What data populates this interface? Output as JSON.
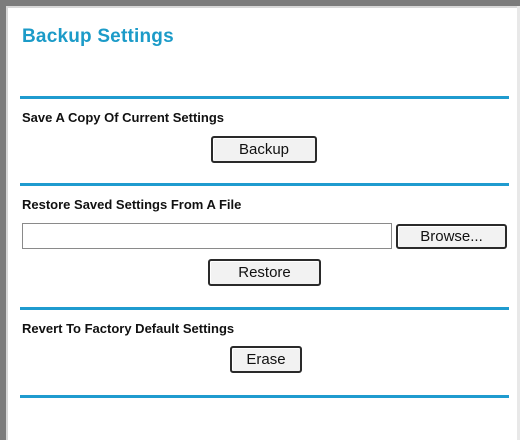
{
  "page": {
    "title": "Backup Settings"
  },
  "backup_section": {
    "label": "Save A Copy Of Current Settings",
    "button_label": "Backup"
  },
  "restore_section": {
    "label": "Restore Saved Settings From A File",
    "file_value": "",
    "browse_label": "Browse...",
    "button_label": "Restore"
  },
  "erase_section": {
    "label": "Revert To Factory Default Settings",
    "button_label": "Erase"
  },
  "colors": {
    "title": "#1c9bc8",
    "rule": "#1f9bcf"
  }
}
